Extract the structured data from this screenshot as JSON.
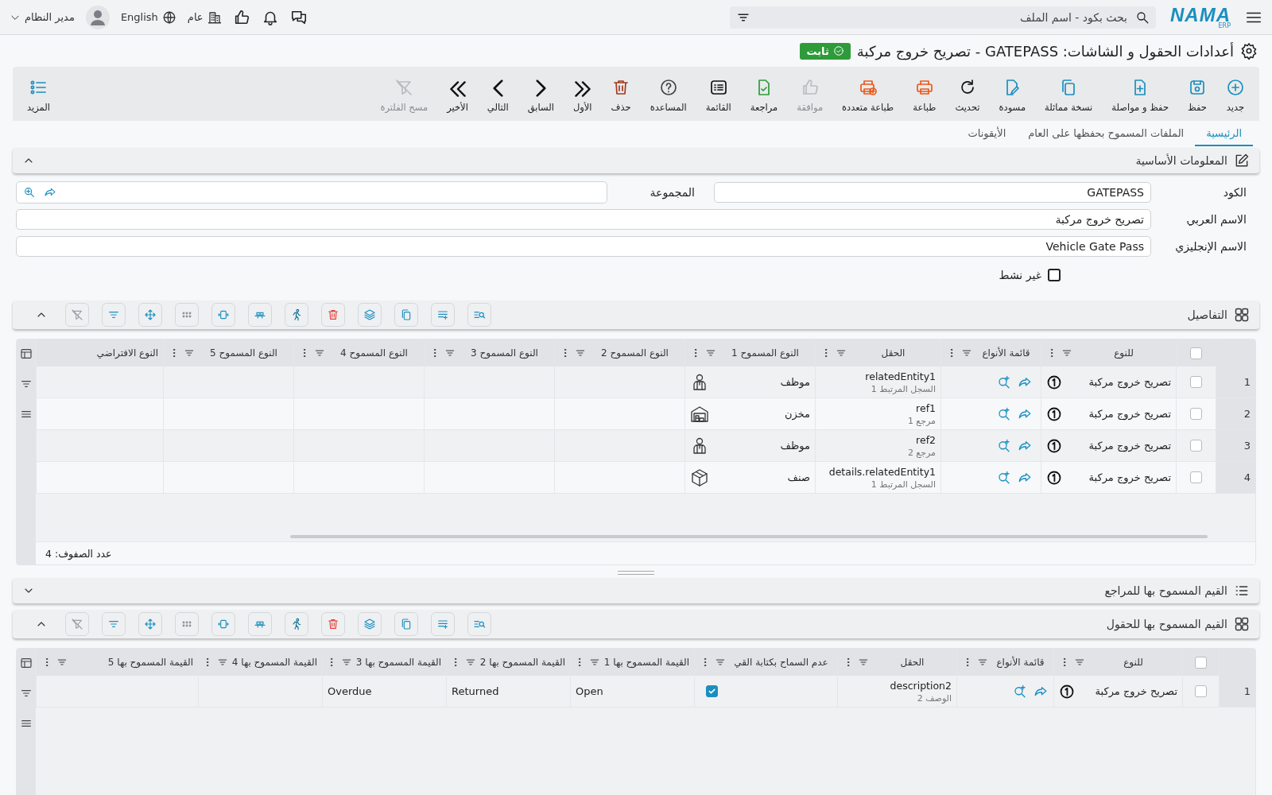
{
  "top_bar": {
    "logo": "NAMA",
    "logo_sub": "ERP",
    "search": {
      "placeholder": "بحث بكود - اسم الملف"
    },
    "branch": "عام",
    "language": "English",
    "user": "مدير النظام"
  },
  "title": {
    "text": "أعدادات الحقول و الشاشات: GATEPASS - تصريح خروج مركبة",
    "badge": "ثابت"
  },
  "toolbar": [
    {
      "label": "جديد",
      "kind": "new",
      "disabled": false
    },
    {
      "label": "حفظ",
      "kind": "save",
      "disabled": false
    },
    {
      "label": "حفظ و مواصلة",
      "kind": "save-continue",
      "disabled": false
    },
    {
      "label": "نسخة مماثلة",
      "kind": "duplicate",
      "disabled": false
    },
    {
      "label": "مسودة",
      "kind": "draft",
      "disabled": false
    },
    {
      "label": "تحديث",
      "kind": "refresh",
      "disabled": false
    },
    {
      "label": "طباعة",
      "kind": "print",
      "disabled": false
    },
    {
      "label": "طباعة متعددة",
      "kind": "print-multi",
      "disabled": false
    },
    {
      "label": "موافقة",
      "kind": "approve",
      "disabled": true
    },
    {
      "label": "مراجعة",
      "kind": "review",
      "disabled": false
    },
    {
      "label": "القائمة",
      "kind": "list",
      "disabled": false
    },
    {
      "label": "المساعدة",
      "kind": "help",
      "disabled": false
    },
    {
      "label": "حذف",
      "kind": "delete",
      "disabled": false
    },
    {
      "label": "الأول",
      "kind": "first",
      "disabled": false
    },
    {
      "label": "السابق",
      "kind": "prev",
      "disabled": false
    },
    {
      "label": "التالي",
      "kind": "next",
      "disabled": false
    },
    {
      "label": "الأخير",
      "kind": "last",
      "disabled": false
    },
    {
      "label": "مسح الفلترة",
      "kind": "clear-filter",
      "disabled": true
    }
  ],
  "more_button": "المزيد",
  "tabs": [
    {
      "label": "الرئيسية",
      "selected": true
    },
    {
      "label": "الملفات المسموح بحفظها على العام",
      "selected": false
    },
    {
      "label": "الأيقونات",
      "selected": false
    }
  ],
  "basic_info": {
    "title": "المعلومات الأساسية",
    "expanded": true,
    "code": {
      "label": "الكود",
      "value": "GATEPASS"
    },
    "group": {
      "label": "المجموعة"
    },
    "arabic_name": {
      "label": "الاسم العربي",
      "value": "تصريح خروج مركبة"
    },
    "english_name": {
      "label": "الاسم الإنجليزي",
      "value": "Vehicle Gate Pass"
    },
    "inactive": {
      "label": "غير نشط",
      "checked": false
    }
  },
  "details": {
    "title": "التفاصيل",
    "expanded": true,
    "all_selected": false,
    "columns": [
      "للنوع",
      "قائمة الأنواع",
      "الحقل",
      "النوع المسموح 1",
      "النوع المسموح 2",
      "النوع المسموح 3",
      "النوع المسموح 4",
      "النوع المسموح 5",
      "النوع الافتراضي"
    ],
    "rows": [
      {
        "number": "1",
        "selected": false,
        "type": "تصريح خروج مركبة",
        "field": "relatedEntity1",
        "field_sub": "السجل المرتبط 1",
        "allowed_1": {
          "text": "موظف",
          "kind": "employee"
        }
      },
      {
        "number": "2",
        "selected": false,
        "type": "تصريح خروج مركبة",
        "field": "ref1",
        "field_sub": "مرجع 1",
        "allowed_1": {
          "text": "مخزن",
          "kind": "warehouse"
        }
      },
      {
        "number": "3",
        "selected": false,
        "type": "تصريح خروج مركبة",
        "field": "ref2",
        "field_sub": "مرجع 2",
        "allowed_1": {
          "text": "موظف",
          "kind": "employee"
        }
      },
      {
        "number": "4",
        "selected": false,
        "type": "تصريح خروج مركبة",
        "field": "details.relatedEntity1",
        "field_sub": "السجل المرتبط 1",
        "allowed_1": {
          "text": "صنف",
          "kind": "item"
        }
      }
    ],
    "row_count": "عدد الصفوف: 4"
  },
  "references": {
    "title": "القيم المسموح بها للمراجع",
    "expanded": false
  },
  "field_values": {
    "title": "القيم المسموح بها للحقول",
    "expanded": true,
    "all_selected": false,
    "columns": [
      "للنوع",
      "قائمة الأنواع",
      "الحقل",
      "عدم السماح بكتابة القي",
      "القيمة المسموح بها 1",
      "القيمة المسموح بها 2",
      "القيمة المسموح بها 3",
      "القيمة المسموح بها 4",
      "القيمة المسموح بها 5"
    ],
    "rows": [
      {
        "number": "1",
        "selected": false,
        "type": "تصريح خروج مركبة",
        "field": "description2",
        "field_sub": "الوصف 2",
        "no_free_text": true,
        "value_1": "Open",
        "value_2": "Returned",
        "value_3": "Overdue"
      }
    ]
  }
}
